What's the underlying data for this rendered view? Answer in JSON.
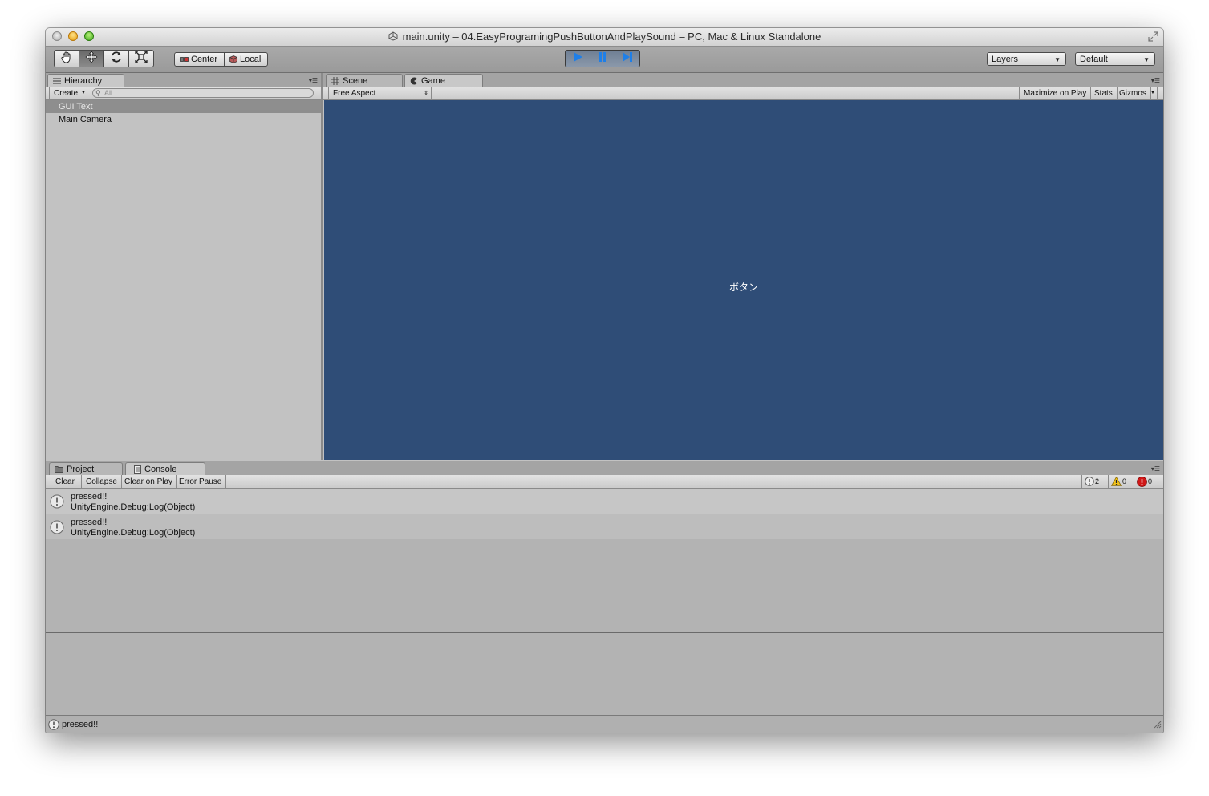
{
  "window": {
    "title": "main.unity – 04.EasyProgramingPushButtonAndPlaySound – PC, Mac & Linux Standalone"
  },
  "toolbar": {
    "tools": [
      "hand-tool",
      "move-tool",
      "rotate-tool",
      "scale-tool"
    ],
    "active_tool": "move-tool",
    "pivot_center": "Center",
    "pivot_local": "Local",
    "playing": true,
    "layers_label": "Layers",
    "layout_label": "Default"
  },
  "hierarchy": {
    "tab_label": "Hierarchy",
    "create_label": "Create",
    "search_placeholder": "All",
    "items": [
      {
        "label": "GUI Text",
        "selected": true
      },
      {
        "label": "Main Camera",
        "selected": false
      }
    ]
  },
  "viewtabs": {
    "scene_label": "Scene",
    "game_label": "Game",
    "active": "Game"
  },
  "game": {
    "aspect_label": "Free Aspect",
    "maximize_label": "Maximize on Play",
    "stats_label": "Stats",
    "gizmos_label": "Gizmos",
    "background_color": "#2f4d77",
    "content_text": "ボタン"
  },
  "bottomtabs": {
    "project_label": "Project",
    "console_label": "Console",
    "active": "Console"
  },
  "console": {
    "clear_label": "Clear",
    "collapse_label": "Collapse",
    "clear_on_play_label": "Clear on Play",
    "error_pause_label": "Error Pause",
    "info_count": "2",
    "warning_count": "0",
    "error_count": "0",
    "entries": [
      {
        "message": "pressed!!",
        "trace": "UnityEngine.Debug:Log(Object)"
      },
      {
        "message": "pressed!!",
        "trace": "UnityEngine.Debug:Log(Object)"
      }
    ]
  },
  "statusbar": {
    "text": "pressed!!"
  }
}
